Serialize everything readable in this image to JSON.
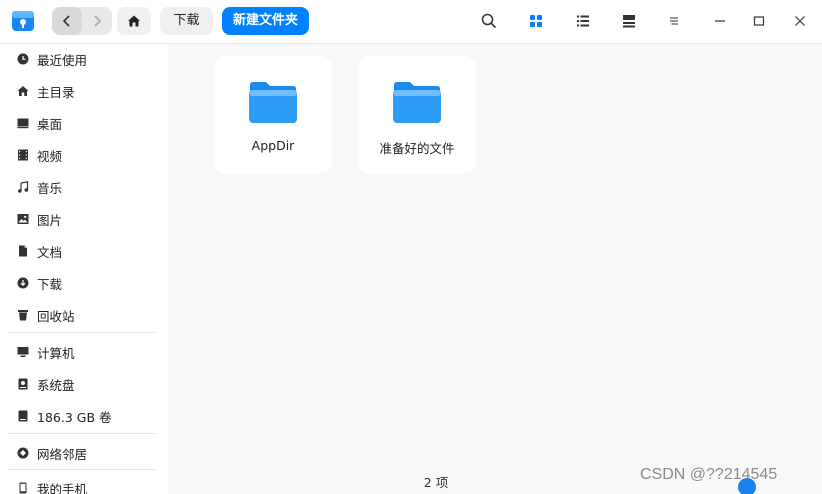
{
  "toolbar": {
    "breadcrumb": "下载",
    "new_folder_label": "新建文件夹",
    "icons": [
      "search-icon",
      "icon-view-icon",
      "list-view-icon",
      "detail-view-icon",
      "menu-icon",
      "minimize-icon",
      "maximize-icon",
      "close-icon"
    ]
  },
  "sidebar": {
    "items": [
      {
        "label": "最近使用",
        "icon": "clock-icon"
      },
      {
        "label": "主目录",
        "icon": "home-icon"
      },
      {
        "label": "桌面",
        "icon": "desktop-icon"
      },
      {
        "label": "视频",
        "icon": "video-icon"
      },
      {
        "label": "音乐",
        "icon": "music-icon"
      },
      {
        "label": "图片",
        "icon": "picture-icon"
      },
      {
        "label": "文档",
        "icon": "document-icon"
      },
      {
        "label": "下载",
        "icon": "download-icon"
      },
      {
        "label": "回收站",
        "icon": "trash-icon"
      },
      {
        "label": "计算机",
        "icon": "computer-icon"
      },
      {
        "label": "系统盘",
        "icon": "system-disk-icon"
      },
      {
        "label": "186.3 GB 卷",
        "icon": "volume-icon"
      },
      {
        "label": "网络邻居",
        "icon": "network-icon"
      },
      {
        "label": "我的手机",
        "icon": "phone-icon"
      }
    ]
  },
  "files": [
    {
      "name": "AppDir"
    },
    {
      "name": "准备好的文件"
    }
  ],
  "status": {
    "count": "2 项"
  },
  "watermark": "CSDN @??214545",
  "colors": {
    "accent": "#0081ff",
    "folder": "#2e9bf7"
  }
}
